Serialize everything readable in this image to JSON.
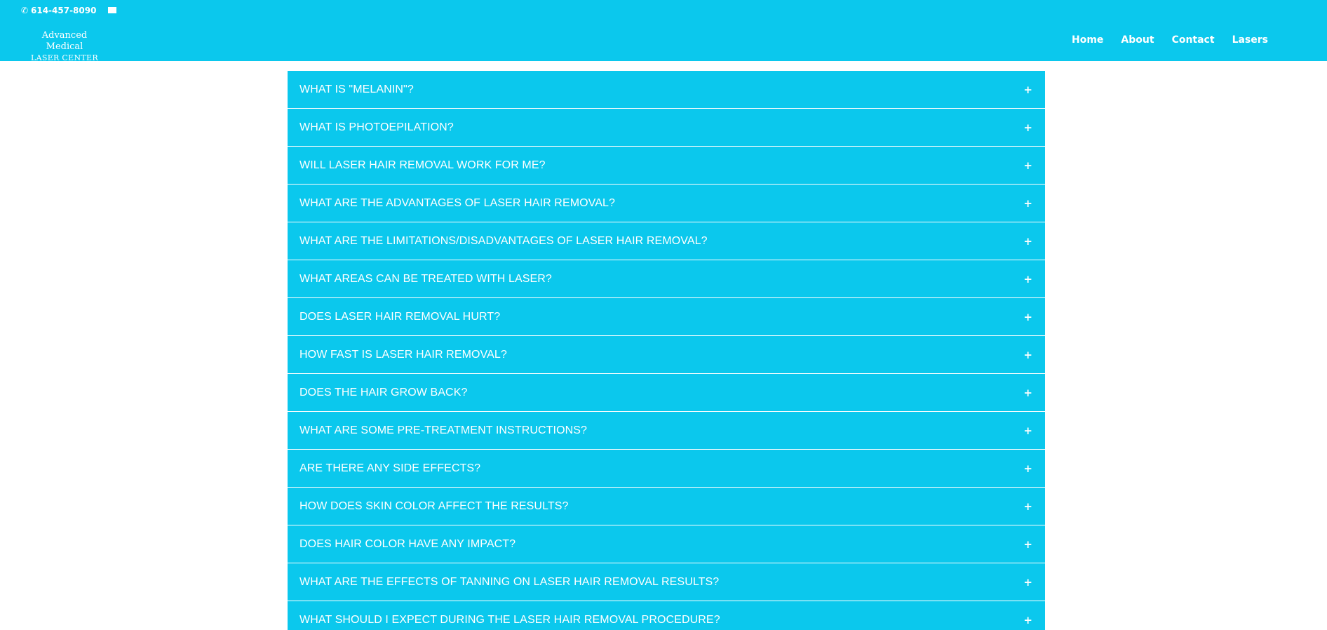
{
  "topbar": {
    "phone": "614-457-8090",
    "phone_icon": "phone-icon",
    "mail_icon": "mail-icon"
  },
  "logo": {
    "line1": "Advanced Medical",
    "line2": "LASER CENTER"
  },
  "nav": [
    "Home",
    "About",
    "Contact",
    "Lasers"
  ],
  "faq": {
    "expand_symbol": "+",
    "items": [
      "WHAT IS \"MELANIN\"?",
      "WHAT IS PHOTOEPILATION?",
      "WILL LASER HAIR REMOVAL WORK FOR ME?",
      "WHAT ARE THE ADVANTAGES OF LASER HAIR REMOVAL?",
      "WHAT ARE THE LIMITATIONS/DISADVANTAGES OF LASER HAIR REMOVAL?",
      "WHAT AREAS CAN BE TREATED WITH LASER?",
      "DOES LASER HAIR REMOVAL HURT?",
      "HOW FAST IS LASER HAIR REMOVAL?",
      "DOES THE HAIR GROW BACK?",
      "WHAT ARE SOME PRE-TREATMENT INSTRUCTIONS?",
      "ARE THERE ANY SIDE EFFECTS?",
      "HOW DOES SKIN COLOR AFFECT THE RESULTS?",
      "DOES HAIR COLOR HAVE ANY IMPACT?",
      "WHAT ARE THE EFFECTS OF TANNING ON LASER HAIR REMOVAL RESULTS?",
      "WHAT SHOULD I EXPECT DURING THE LASER HAIR REMOVAL PROCEDURE?"
    ]
  },
  "colors": {
    "accent": "#0bc8ed",
    "text": "#ffffff",
    "background": "#ffffff"
  }
}
